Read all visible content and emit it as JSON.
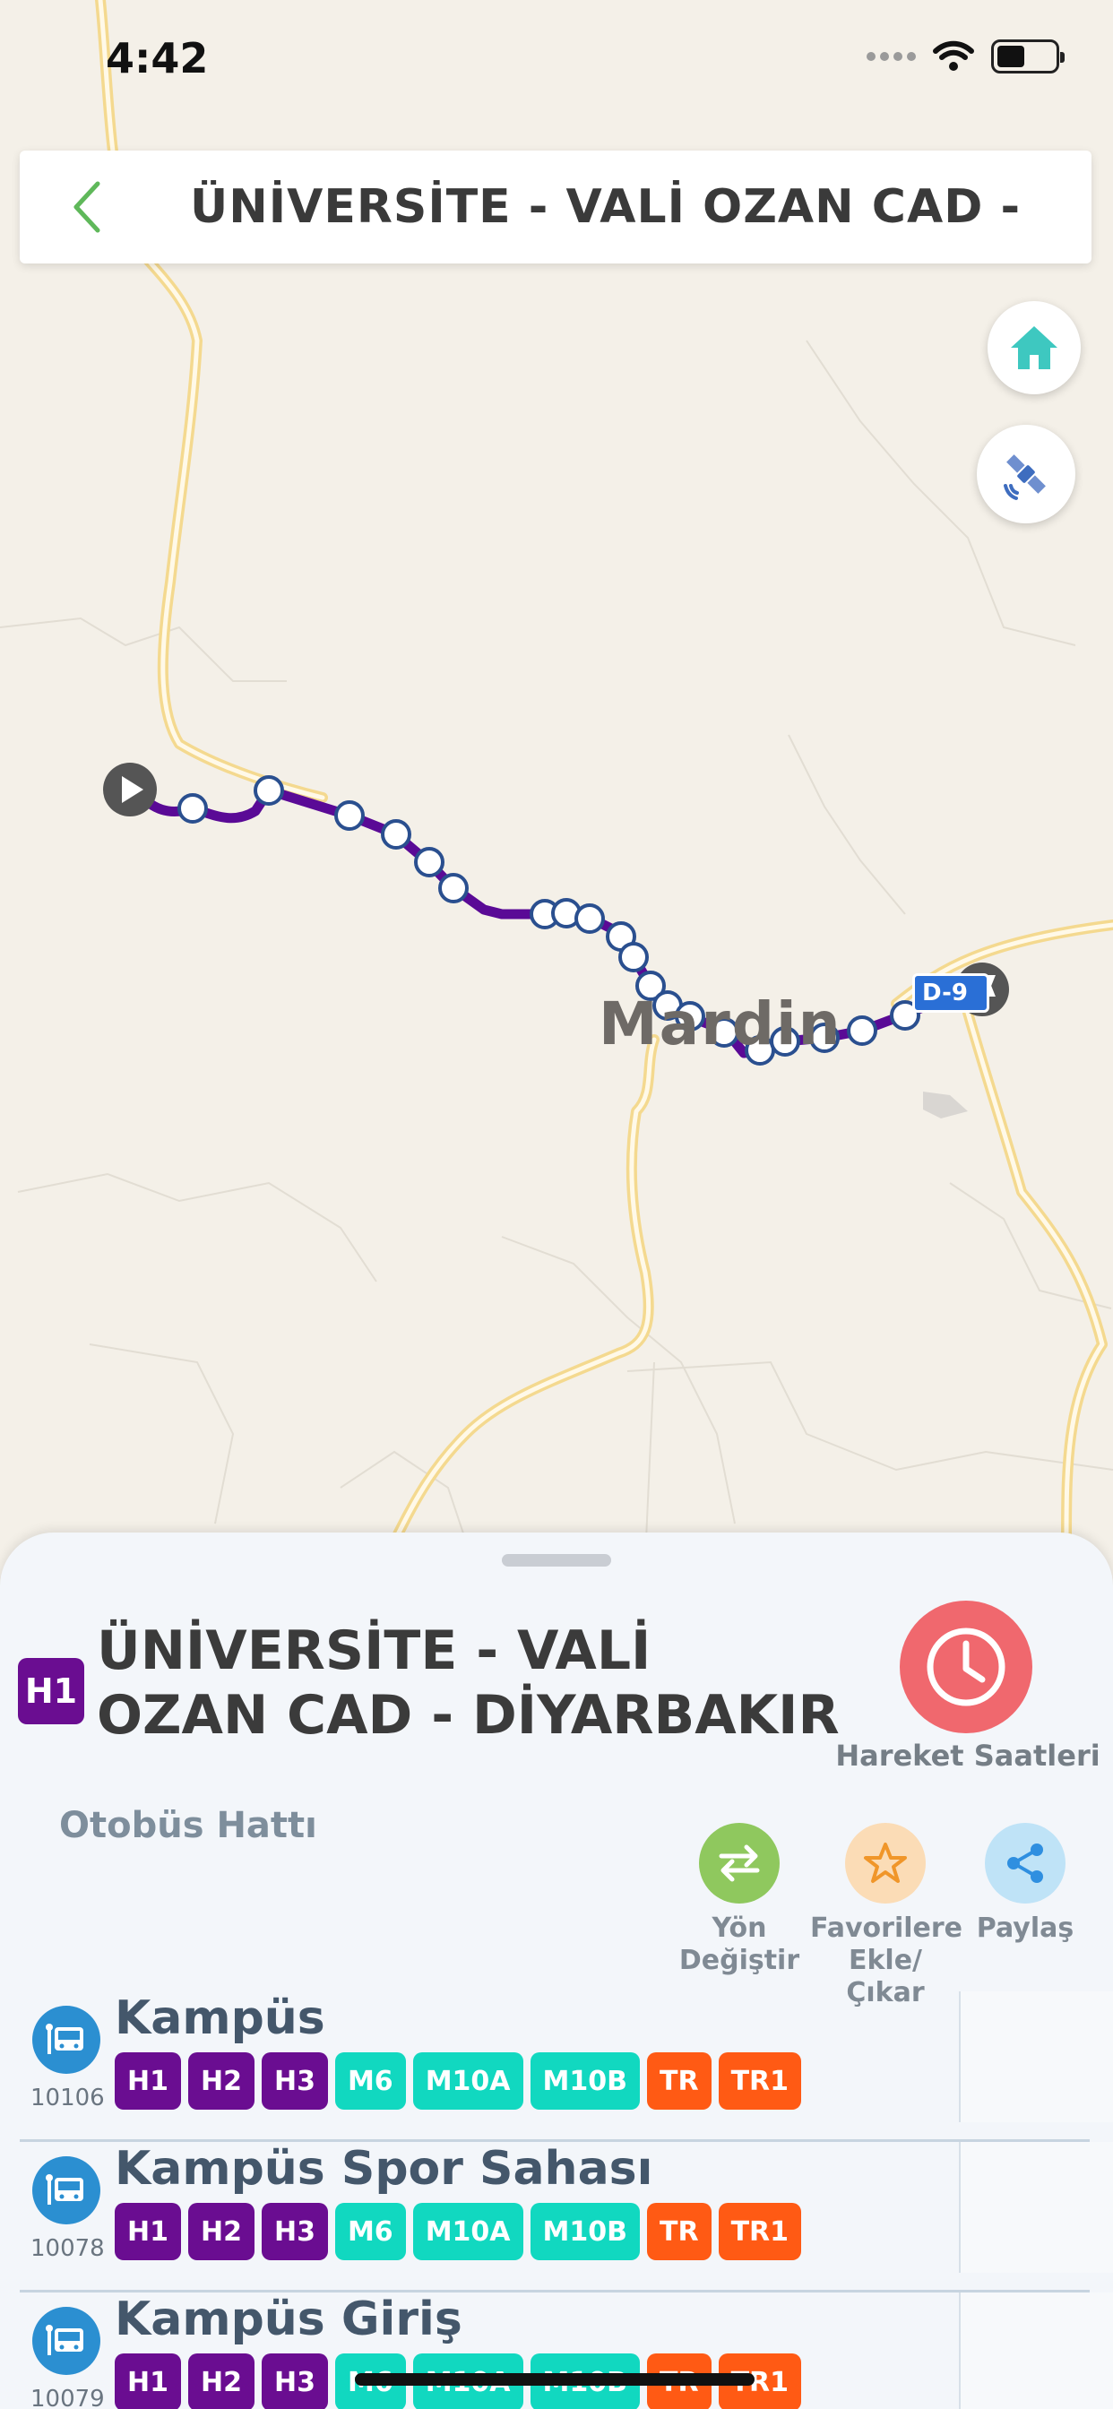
{
  "status_bar": {
    "time": "4:42"
  },
  "header": {
    "title": "ÜNİVERSİTE - VALİ OZAN CAD -"
  },
  "map": {
    "city_label": "Mardin",
    "road_shield": "D-9",
    "route_color": "#5a0a96",
    "map_buttons": [
      "home-icon",
      "gps-satellite-icon"
    ]
  },
  "sheet": {
    "line_code": "H1",
    "route_title": "ÜNİVERSİTE - VALİ OZAN CAD - DİYARBAKIR MARD...",
    "schedule_label": "Hareket Saatleri",
    "subtitle": "Otobüs Hattı",
    "actions": [
      {
        "label_1": "Yön",
        "label_2": "Değiştir",
        "icon": "swap-arrows-icon"
      },
      {
        "label_1": "Favorilere",
        "label_2": "Ekle/Çıkar",
        "icon": "star-icon"
      },
      {
        "label_1": "Paylaş",
        "label_2": "",
        "icon": "share-icon"
      }
    ]
  },
  "stops": [
    {
      "name": "Kampüs",
      "code": "10106",
      "lines": [
        "H1",
        "H2",
        "H3",
        "M6",
        "M10A",
        "M10B",
        "TR",
        "TR1"
      ]
    },
    {
      "name": "Kampüs Spor Sahası",
      "code": "10078",
      "lines": [
        "H1",
        "H2",
        "H3",
        "M6",
        "M10A",
        "M10B",
        "TR",
        "TR1"
      ]
    },
    {
      "name": "Kampüs Giriş",
      "code": "10079",
      "lines": [
        "H1",
        "H2",
        "H3",
        "M6",
        "M10A",
        "M10B",
        "TR",
        "TR1"
      ]
    }
  ],
  "line_colors": {
    "H": "#6a0d91",
    "M": "#11d8c0",
    "T": "#ff5a14"
  }
}
